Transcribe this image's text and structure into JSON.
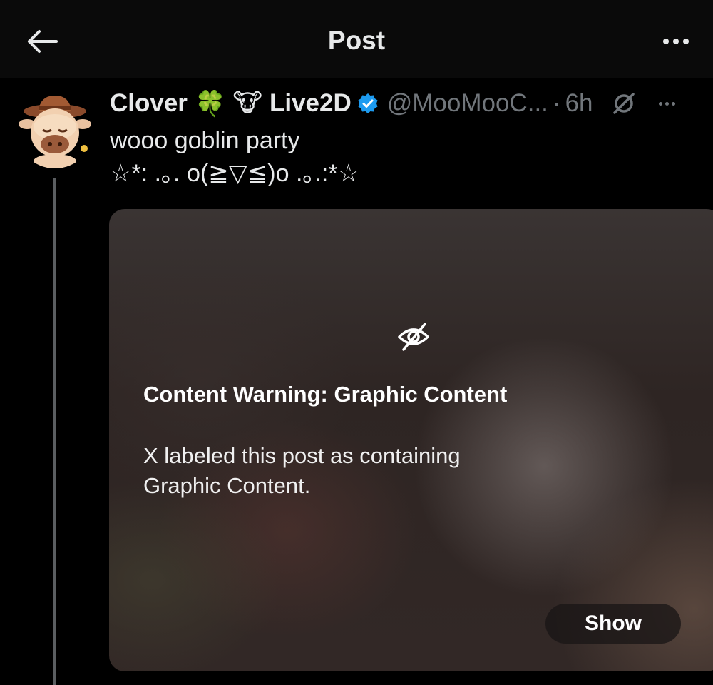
{
  "header": {
    "title": "Post",
    "back_icon": "arrow-left-icon",
    "more_icon": "more-horizontal-icon"
  },
  "post": {
    "author": {
      "name_part1": "Clover",
      "emoji1": "🍀",
      "emoji2": "🐮",
      "name_part2": "Live2D",
      "handle": "@MooMooC...",
      "verified": true
    },
    "separator": "·",
    "time": "6h",
    "text_line1": "wooo goblin party",
    "text_line2": "☆*: .｡. o(≧▽≦)o .｡.:*☆",
    "media": {
      "icon": "eye-slash-icon",
      "warning_title": "Content Warning: Graphic Content",
      "warning_body": "X labeled this post as containing Graphic Content.",
      "show_label": "Show"
    }
  },
  "colors": {
    "background": "#000000",
    "text_primary": "#e7e9ea",
    "text_secondary": "#71767b",
    "verified_blue": "#1d9bf0"
  }
}
